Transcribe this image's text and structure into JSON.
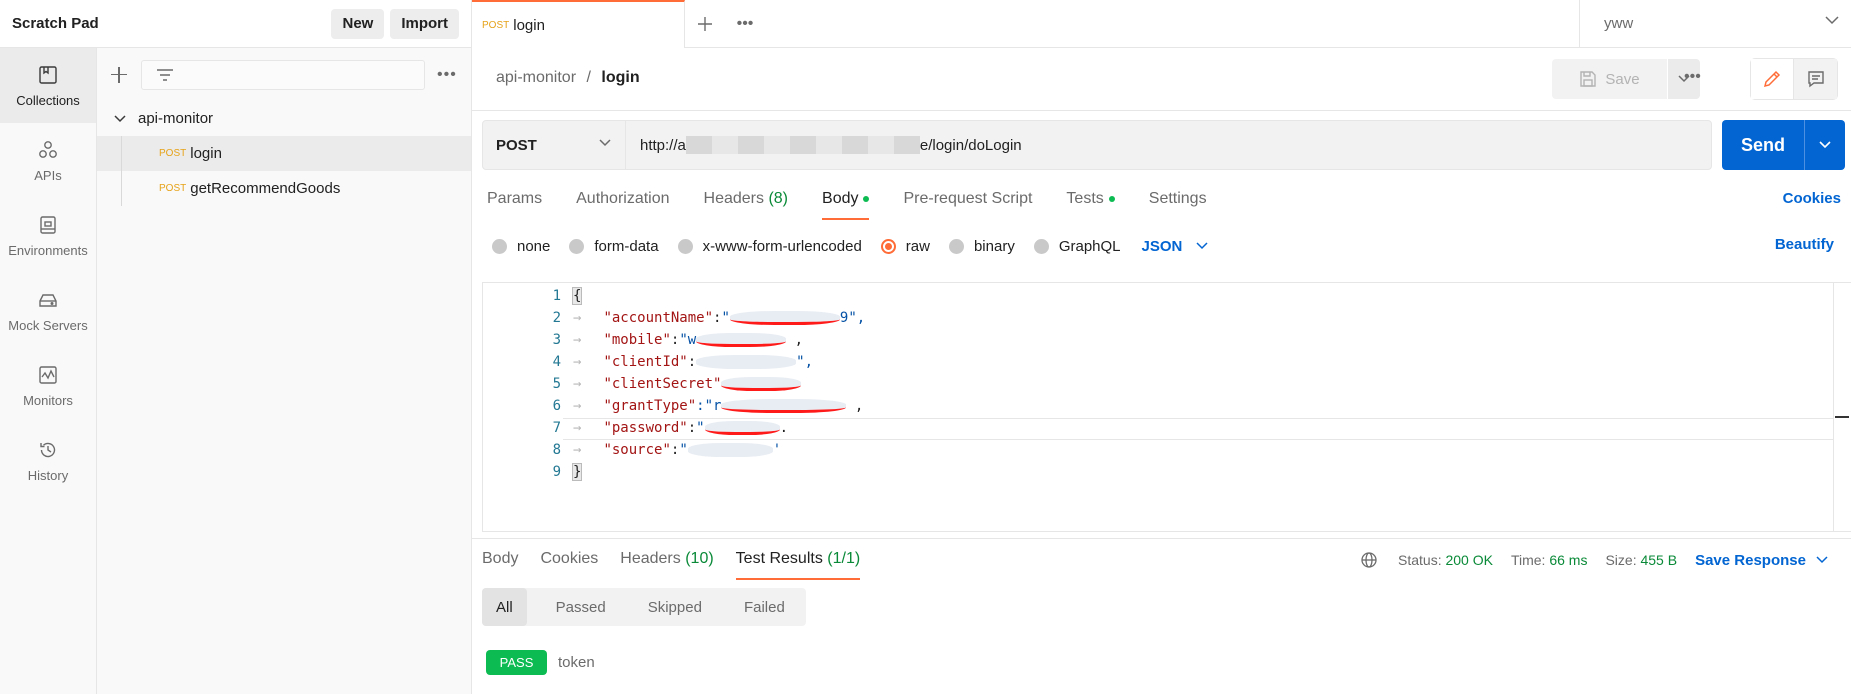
{
  "workspace": {
    "title": "Scratch Pad",
    "new_label": "New",
    "import_label": "Import"
  },
  "rail": [
    {
      "label": "Collections",
      "icon": "collections-icon",
      "active": true
    },
    {
      "label": "APIs",
      "icon": "apis-icon"
    },
    {
      "label": "Environments",
      "icon": "environments-icon"
    },
    {
      "label": "Mock Servers",
      "icon": "mock-servers-icon"
    },
    {
      "label": "Monitors",
      "icon": "monitors-icon"
    },
    {
      "label": "History",
      "icon": "history-icon"
    }
  ],
  "collections": {
    "folder": "api-monitor",
    "requests": [
      {
        "method": "POST",
        "name": "login",
        "active": true
      },
      {
        "method": "POST",
        "name": "getRecommendGoods"
      }
    ]
  },
  "tab": {
    "method": "POST",
    "name": "login"
  },
  "environment": {
    "selected": "yww"
  },
  "breadcrumb": {
    "collection": "api-monitor",
    "separator": "/",
    "request": "login"
  },
  "header": {
    "save_label": "Save"
  },
  "request": {
    "method": "POST",
    "url_prefix": "http://a",
    "url_suffix": "e/login/doLogin",
    "send_label": "Send"
  },
  "request_tabs": {
    "params": "Params",
    "authorization": "Authorization",
    "headers": "Headers",
    "headers_count": "(8)",
    "body": "Body",
    "prerequest": "Pre-request Script",
    "tests": "Tests",
    "settings": "Settings",
    "cookies": "Cookies"
  },
  "body_types": {
    "none": "none",
    "form_data": "form-data",
    "urlencoded": "x-www-form-urlencoded",
    "raw": "raw",
    "binary": "binary",
    "graphql": "GraphQL",
    "format": "JSON",
    "beautify": "Beautify"
  },
  "code": {
    "line_numbers": [
      "1",
      "2",
      "3",
      "4",
      "5",
      "6",
      "7",
      "8",
      "9"
    ],
    "open_brace": "{",
    "close_brace": "}",
    "keys": [
      "\"accountName\"",
      "\"mobile\"",
      "\"clientId\"",
      "\"clientSecret\"",
      "\"grantType\"",
      "\"password\"",
      "\"source\""
    ],
    "visible_value_fragments": [
      "\"",
      "9\",",
      "\"w",
      ",",
      ":",
      "\",",
      "",
      ":\"r",
      ",",
      "\"",
      ".",
      "\"",
      "'"
    ]
  },
  "response_tabs": {
    "body": "Body",
    "cookies": "Cookies",
    "headers": "Headers",
    "headers_count": "(10)",
    "test_results": "Test Results",
    "test_count": "(1/1)"
  },
  "response_status": {
    "status_label": "Status:",
    "status_value": "200 OK",
    "time_label": "Time:",
    "time_value": "66 ms",
    "size_label": "Size:",
    "size_value": "455 B",
    "save_response": "Save Response"
  },
  "test_filters": [
    "All",
    "Passed",
    "Skipped",
    "Failed"
  ],
  "test_results": [
    {
      "status": "PASS",
      "name": "token"
    }
  ],
  "colors": {
    "accent": "#ff6c37",
    "primary": "#0265d2",
    "success": "#0cbb52",
    "post": "#e6a31a"
  }
}
